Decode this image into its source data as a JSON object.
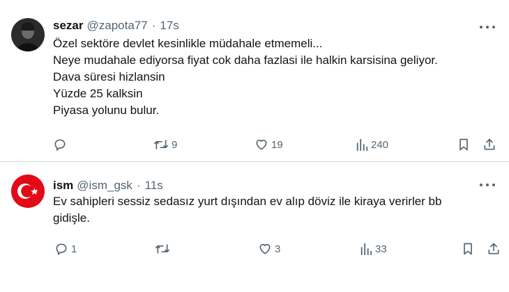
{
  "tweets": [
    {
      "display_name": "sezar",
      "handle": "@zapota77",
      "separator": "·",
      "time": "17s",
      "lines": [
        "Özel sektöre devlet kesinlikle müdahale etmemeli...",
        "Neye mudahale ediyorsa fiyat cok daha fazlasi ile halkin karsisina geliyor.",
        "Dava süresi hizlansin",
        "Yüzde 25 kalksin",
        "Piyasa yolunu bulur."
      ],
      "replies": "",
      "retweets": "9",
      "likes": "19",
      "views": "240"
    },
    {
      "display_name": "ism",
      "handle": "@ism_gsk",
      "separator": "·",
      "time": "11s",
      "lines": [
        "Ev sahipleri sessiz sedasız yurt dışından ev alıp döviz ile kiraya verirler bb",
        "gidişle."
      ],
      "replies": "1",
      "retweets": "",
      "likes": "3",
      "views": "33"
    }
  ],
  "icons": {
    "reply": "reply-icon",
    "retweet": "retweet-icon",
    "like": "heart-icon",
    "views": "views-chart-icon",
    "bookmark": "bookmark-icon",
    "share": "share-icon",
    "more": "more-dots-icon"
  },
  "colors": {
    "text": "#0f1419",
    "secondary": "#536471",
    "divider": "#cfd9de",
    "flag_red": "#e30a17"
  }
}
